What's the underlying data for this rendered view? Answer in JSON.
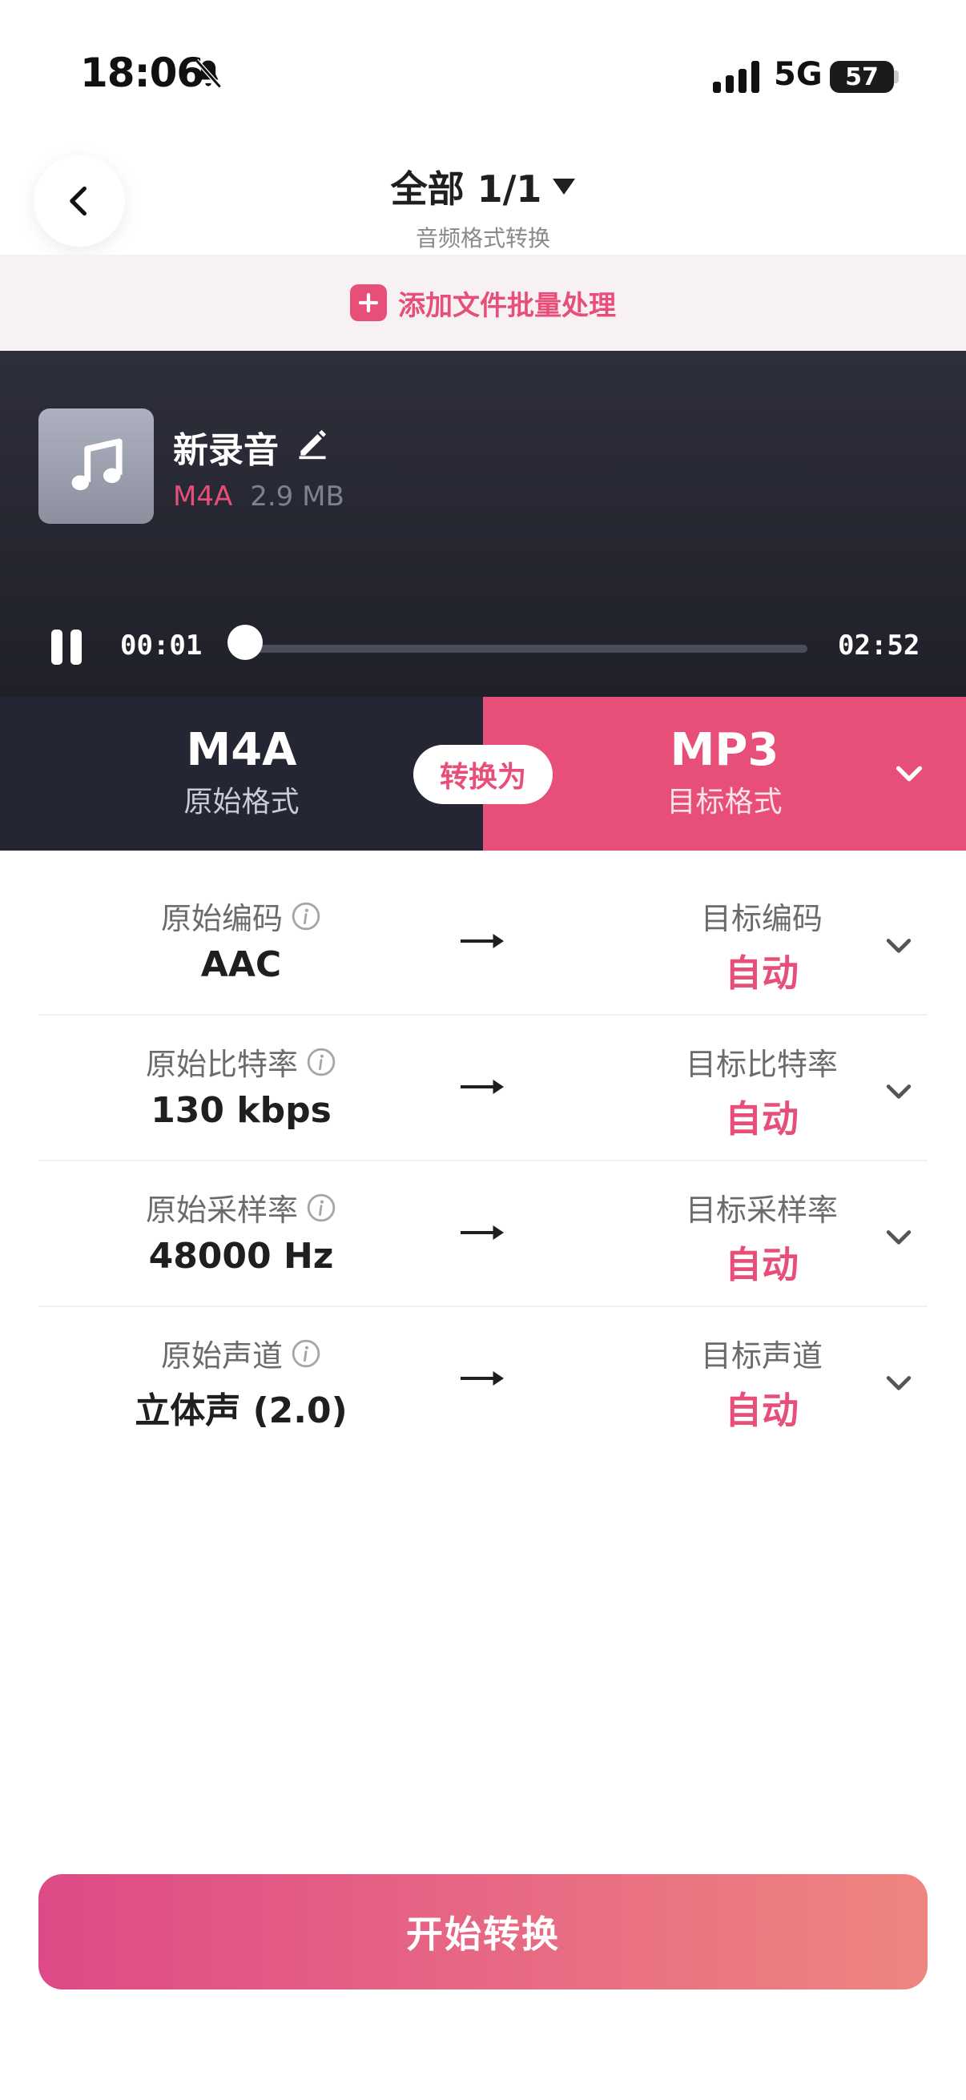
{
  "status_bar": {
    "time": "18:06",
    "network": "5G",
    "battery": "57"
  },
  "header": {
    "title": "全部 1/1",
    "subtitle": "音频格式转换"
  },
  "add_bar": {
    "label": "添加文件批量处理"
  },
  "player": {
    "file_name": "新录音",
    "format": "M4A",
    "size": "2.9 MB",
    "current_time": "00:01",
    "total_time": "02:52",
    "progress": 0.006
  },
  "format_bar": {
    "source_format": "M4A",
    "source_label": "原始格式",
    "convert_label": "转换为",
    "target_format": "MP3",
    "target_label": "目标格式"
  },
  "params": [
    {
      "src_label": "原始编码",
      "src_value": "AAC",
      "dst_label": "目标编码",
      "dst_value": "自动"
    },
    {
      "src_label": "原始比特率",
      "src_value": "130 kbps",
      "dst_label": "目标比特率",
      "dst_value": "自动"
    },
    {
      "src_label": "原始采样率",
      "src_value": "48000 Hz",
      "dst_label": "目标采样率",
      "dst_value": "自动"
    },
    {
      "src_label": "原始声道",
      "src_value": "立体声 (2.0)",
      "dst_label": "目标声道",
      "dst_value": "自动"
    }
  ],
  "start_button": {
    "label": "开始转换"
  },
  "colors": {
    "accent": "#e84f78",
    "dark": "#242633",
    "button_start": "#de4a87",
    "button_end": "#ef8580"
  },
  "icons": [
    "bell-off-icon",
    "signal-icon",
    "battery-icon",
    "chevron-left-icon",
    "caret-down-icon",
    "plus-icon",
    "music-note-icon",
    "pencil-icon",
    "pause-icon",
    "chevron-down-icon",
    "info-icon",
    "arrow-right-icon"
  ]
}
